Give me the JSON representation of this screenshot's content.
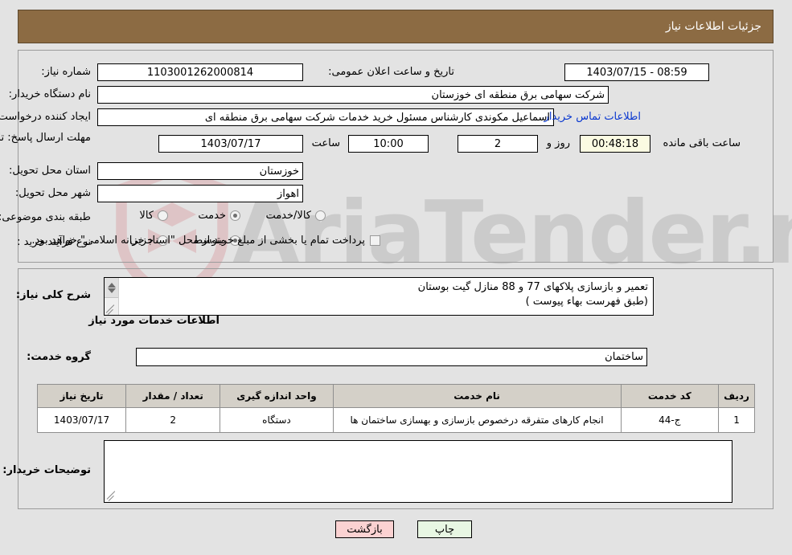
{
  "banner": {
    "title": "جزئیات اطلاعات نیاز"
  },
  "watermark": {
    "text": "AriaTender",
    "suffix": ".net"
  },
  "fields": {
    "need_number_label": "شماره نیاز:",
    "need_number_value": "1103001262000814",
    "announce_label": "تاریخ و ساعت اعلان عمومی:",
    "announce_value": "08:59 - 1403/07/15",
    "buyer_org_label": "نام دستگاه خریدار:",
    "buyer_org_value": "شرکت سهامی برق منطقه ای خوزستان",
    "creator_label": "ایجاد کننده درخواست:",
    "creator_value": "اسماعیل مکوندی کارشناس مسئول خرید خدمات شرکت سهامی برق منطقه ای",
    "contact_link": "اطلاعات تماس خریدار",
    "deadline_label": "مهلت ارسال پاسخ: تا تاریخ:",
    "deadline_date": "1403/07/17",
    "deadline_hour_label": "ساعت",
    "deadline_hour": "10:00",
    "days_value": "2",
    "days_unit": "روز و",
    "countdown": "00:48:18",
    "countdown_suffix": "ساعت باقی مانده",
    "province_label": "استان محل تحویل:",
    "province_value": "خوزستان",
    "city_label": "شهر محل تحویل:",
    "city_value": "اهواز",
    "category_label": "طبقه بندی موضوعی:",
    "process_label": "نوع فرآیند خرید :",
    "treasury_note": "پرداخت تمام یا بخشی از مبلغ خرید،از محل \"اسناد خزانه اسلامی\" خواهد بود."
  },
  "category_options": [
    {
      "label": "کالا",
      "selected": false
    },
    {
      "label": "خدمت",
      "selected": true
    },
    {
      "label": "کالا/خدمت",
      "selected": false
    }
  ],
  "process_options": [
    {
      "label": "جزیی",
      "selected": false
    },
    {
      "label": "متوسط",
      "selected": true
    }
  ],
  "description": {
    "label": "شرح کلی نیاز:",
    "value": "تعمیر و بازسازی پلاکهای  77 و 88 منازل گیت بوستان\n(طبق  فهرست بهاء پیوست )"
  },
  "services_section": {
    "heading": "اطلاعات خدمات مورد نیاز",
    "group_label": "گروه خدمت:",
    "group_value": "ساختمان"
  },
  "table": {
    "headers": [
      "ردیف",
      "کد خدمت",
      "نام خدمت",
      "واحد اندازه گیری",
      "تعداد / مقدار",
      "تاریخ نیاز"
    ],
    "rows": [
      [
        "1",
        "ج-44",
        "انجام کارهای متفرقه درخصوص بازسازی و بهسازی ساختمان ها",
        "دستگاه",
        "2",
        "1403/07/17"
      ]
    ]
  },
  "buyer_comments": {
    "label": "توضیحات خریدار:",
    "value": ""
  },
  "buttons": {
    "print": "چاپ",
    "back": "بازگشت"
  },
  "colors": {
    "banner_bg": "#8c6b43",
    "page_bg": "#e3e3e3",
    "link": "#0a38d0",
    "print_bg": "#e8f7e3",
    "back_bg": "#fbd2d2",
    "countdown_bg": "#fbfbe2"
  }
}
